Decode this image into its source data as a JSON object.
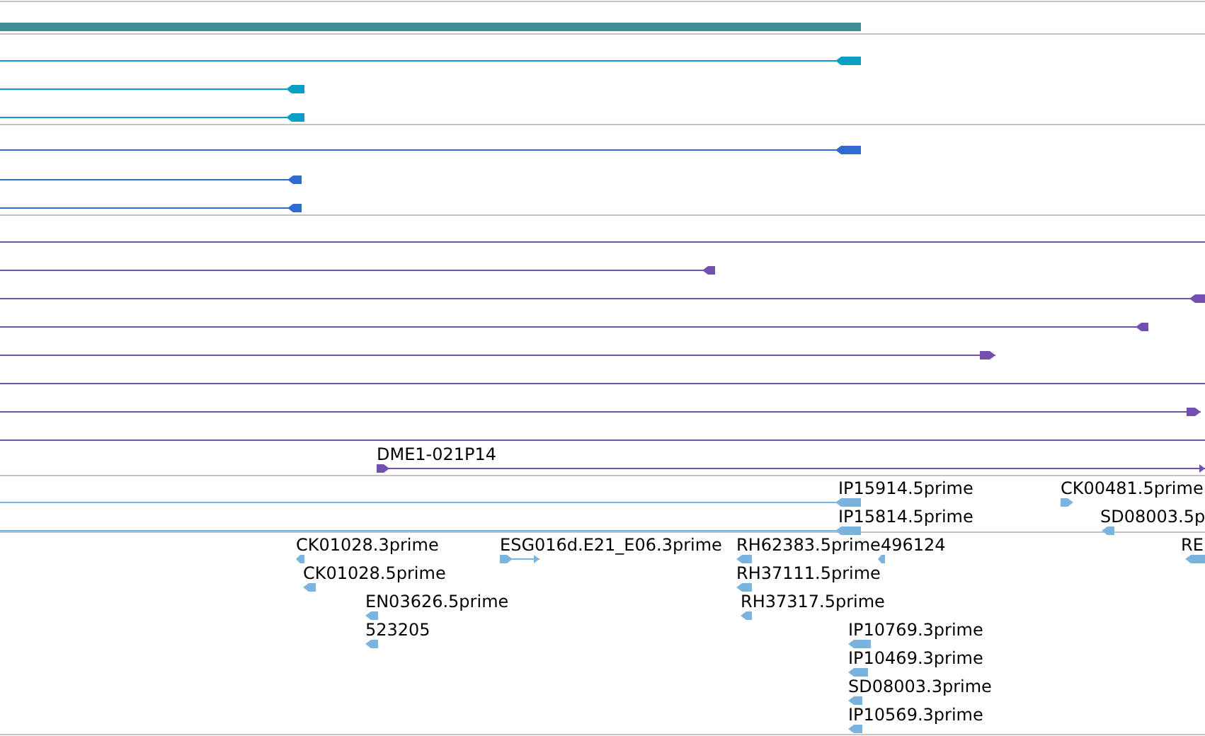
{
  "tracks": [
    {
      "color": "#3a8f94",
      "features": [
        {
          "kind": "bar"
        }
      ]
    },
    {
      "color": "#0aa0c4",
      "features": [
        {
          "kind": "arrow",
          "reverse": true
        },
        {
          "kind": "arrow",
          "reverse": true
        },
        {
          "kind": "arrow",
          "reverse": true
        }
      ]
    },
    {
      "color": "#2f6ad0",
      "features": [
        {
          "kind": "arrow",
          "reverse": true
        },
        {
          "kind": "arrow",
          "reverse": true
        },
        {
          "kind": "arrow",
          "reverse": true
        }
      ]
    },
    {
      "color": "#7350b0",
      "features": [
        {
          "kind": "span"
        },
        {
          "kind": "arrow",
          "reverse": true
        },
        {
          "kind": "arrow",
          "reverse": true
        },
        {
          "kind": "arrow",
          "reverse": true
        },
        {
          "kind": "arrow",
          "reverse": false
        },
        {
          "kind": "span"
        },
        {
          "kind": "arrow",
          "reverse": false
        },
        {
          "kind": "span"
        },
        {
          "kind": "arrow",
          "reverse": false,
          "label": "DME1-021P14"
        }
      ]
    },
    {
      "color": "#7ab4de",
      "features": [
        {
          "kind": "arrow",
          "reverse": true,
          "label": "IP15914.5prime"
        },
        {
          "kind": "arrow",
          "reverse": true,
          "label": "IP15814.5prime"
        },
        {
          "kind": "arrow",
          "reverse": false,
          "label": "CK00481.5prime"
        },
        {
          "kind": "arrow",
          "reverse": true,
          "label": "SD08003.5p"
        }
      ]
    },
    {
      "color": "#7ab4de",
      "features": [
        {
          "kind": "arrow",
          "reverse": true,
          "label": "CK01028.3prime"
        },
        {
          "kind": "arrow",
          "reverse": false,
          "label": "ESG016d.E21_E06.3prime"
        },
        {
          "kind": "arrow",
          "reverse": true,
          "label": "RH62383.5prime"
        },
        {
          "kind": "arrow",
          "reverse": true,
          "label": "496124"
        },
        {
          "kind": "arrow",
          "reverse": true,
          "label": "RE"
        },
        {
          "kind": "arrow",
          "reverse": true,
          "label": "CK01028.5prime"
        },
        {
          "kind": "arrow",
          "reverse": true,
          "label": "RH37111.5prime"
        },
        {
          "kind": "arrow",
          "reverse": true,
          "label": "EN03626.5prime"
        },
        {
          "kind": "arrow",
          "reverse": true,
          "label": "RH37317.5prime"
        },
        {
          "kind": "arrow",
          "reverse": true,
          "label": "523205"
        },
        {
          "kind": "arrow",
          "reverse": true,
          "label": "IP10769.3prime"
        },
        {
          "kind": "arrow",
          "reverse": true,
          "label": "IP10469.3prime"
        },
        {
          "kind": "arrow",
          "reverse": true,
          "label": "SD08003.3prime"
        },
        {
          "kind": "arrow",
          "reverse": true,
          "label": "IP10569.3prime"
        }
      ]
    }
  ]
}
